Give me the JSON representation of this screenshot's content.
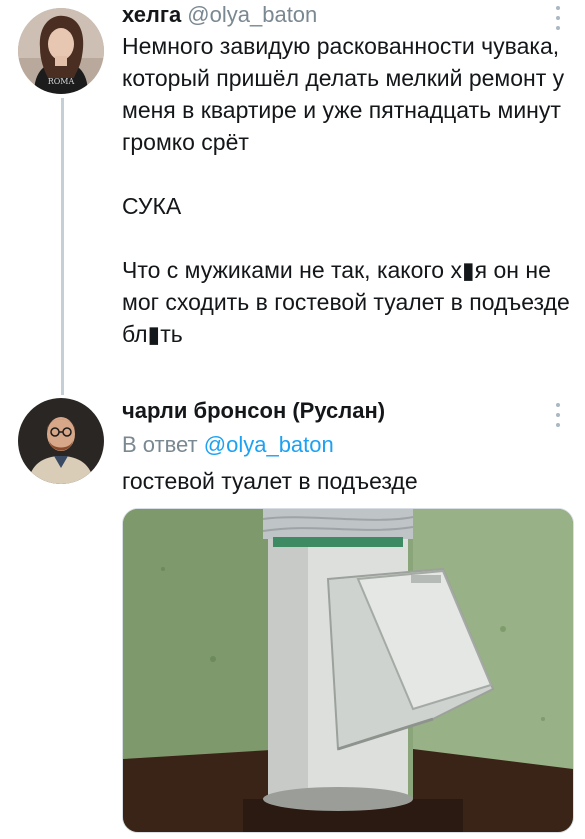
{
  "tweets": [
    {
      "author_name": "хелга",
      "handle": "@olya_baton",
      "paragraphs": [
        "Немного завидую раскованности чувака, который пришёл делать мелкий ремонт у меня в квартире и уже пятнадцать минут громко срёт",
        "СУКА",
        "Что с мужиками не так, какого х▮я он не мог сходить в гостевой туалет в подъезде бл▮ть"
      ]
    },
    {
      "author_name": "чарли бронсон (Руслан)",
      "reply_prefix": "В ответ",
      "reply_mention": "@olya_baton",
      "text": "гостевой туалет в подъезде",
      "image": {
        "alt_icon": "garbage-chute-photo"
      }
    }
  ],
  "colors": {
    "text": "#14171a",
    "secondary": "#7a8891",
    "link": "#1da1f2",
    "thread_line": "#c4cfd6",
    "wall_green": "#8aa57a",
    "chute_metal": "#d9dcd8"
  },
  "icons": {
    "more": "more-vertical-icon"
  }
}
